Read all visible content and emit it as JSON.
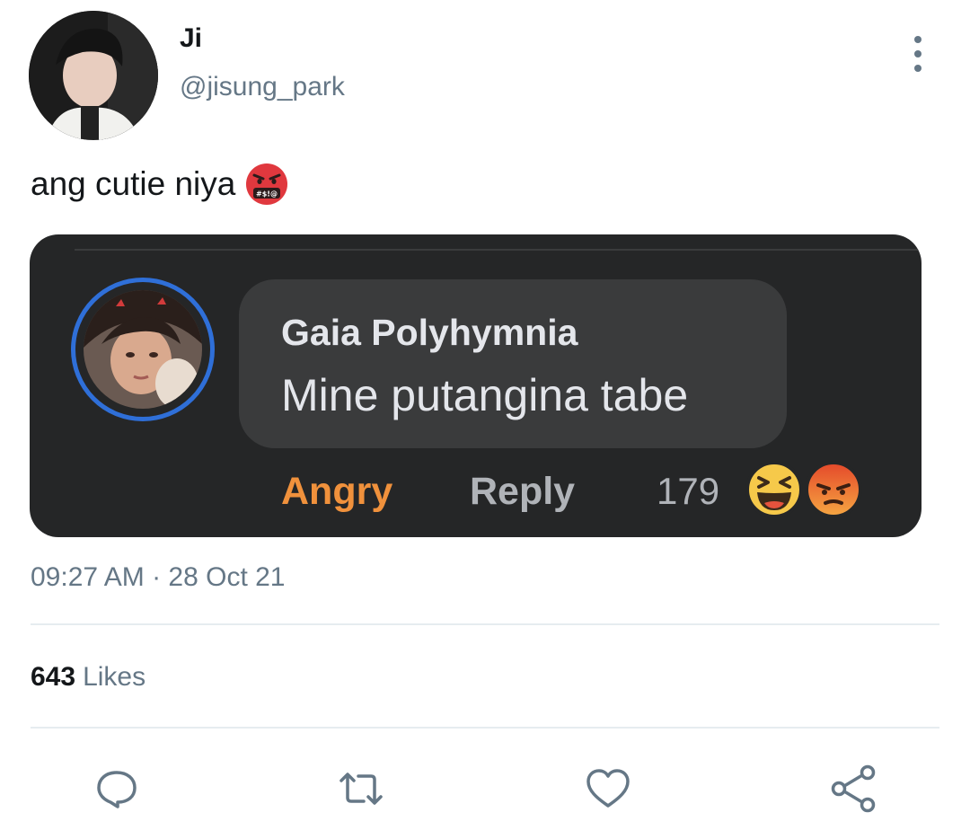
{
  "user": {
    "display_name": "Ji",
    "handle": "@jisung_park"
  },
  "tweet": {
    "text": "ang cutie niya",
    "emoji": "face-with-symbols-on-mouth",
    "timestamp": "09:27 AM · 28 Oct 21"
  },
  "embedded_comment": {
    "author": "Gaia Polyhymnia",
    "text": "Mine putangina tabe",
    "reaction_label": "Angry",
    "reply_label": "Reply",
    "reaction_count": "179",
    "reactions": [
      "haha",
      "angry"
    ],
    "reaction_color": "#f0913c"
  },
  "stats": {
    "likes_count": "643",
    "likes_label": "Likes"
  },
  "actions": [
    "reply-icon",
    "retweet-icon",
    "like-icon",
    "share-icon"
  ],
  "colors": {
    "secondary_text": "#657786",
    "divider": "#e6ecf0",
    "embed_background": "#252627",
    "avatar_ring": "#2f6fd8"
  }
}
